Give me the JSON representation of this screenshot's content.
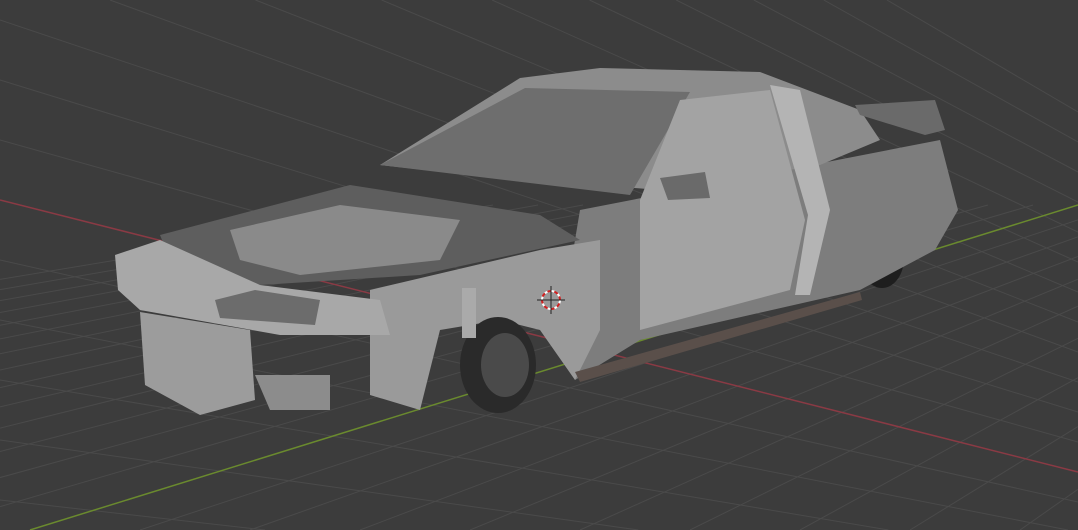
{
  "viewport": {
    "background_color": "#3c3c3c",
    "grid_color": "#4a4a4a",
    "x_axis_color": "#8a3a44",
    "y_axis_color": "#6a8a2e",
    "object": "car-body-model",
    "object_color": "#8e8e8e",
    "cursor_icon": "3d-cursor-icon"
  }
}
